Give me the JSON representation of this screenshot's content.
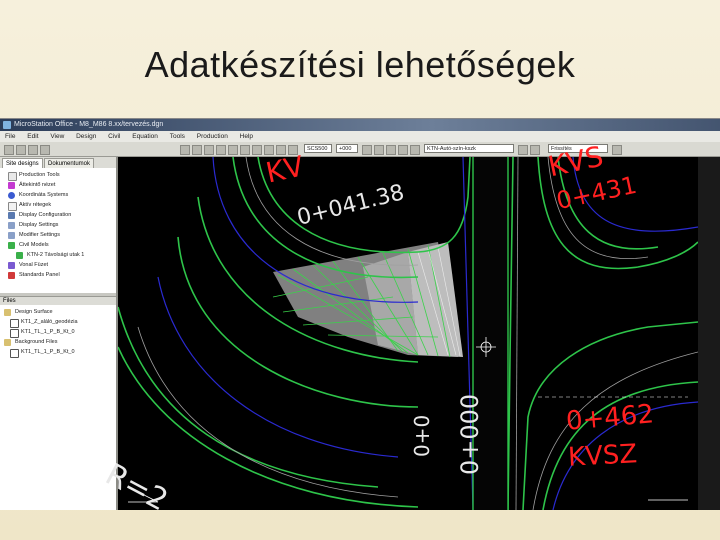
{
  "slide": {
    "title": "Adatkészítési lehetőségek"
  },
  "app": {
    "window_title": "MicroStation Office - M8_M86 8.xx/tervezés.dgn",
    "menu": [
      "File",
      "Edit",
      "View",
      "Design",
      "Civil",
      "Equation",
      "Tools",
      "Production",
      "Help"
    ],
    "combos": {
      "scale": "SCS500",
      "level": "+000",
      "feature": "KTN-Autó-szín-kszk",
      "style": "Frissítés"
    }
  },
  "left_panel": {
    "tabs": [
      "Site designs",
      "Dokumentumok"
    ],
    "tree": [
      "Production Tools",
      "Áttekintő nézet",
      "Koordináta Systems",
      "Aktív rétegek",
      "Display Configuration",
      "Display Settings",
      "Modifier Settings",
      "Civil Models",
      "KTN-2 Távolsági utak 1",
      "Vonal Füzet",
      "Standards Panel"
    ],
    "files_header": "Files",
    "files": [
      "Design Surface",
      "KT1_Z_aláló_geodézia",
      "KT1_TL_1_P_B_Kt_0",
      "Background Files",
      "KT1_TL_1_P_B_Kt_0"
    ]
  },
  "viewport": {
    "labels": {
      "station_top_left": "0+041.38",
      "station_top_right": "0+431",
      "station_bottom_right": "0+462",
      "kvsz_bottom": "KVSZ",
      "kvsz_top_left": "KV",
      "kvsz_top_right": "KVS",
      "vertical_station_a": "0+0",
      "vertical_station_b": "0+000",
      "radius_label": "R=2"
    },
    "colors": {
      "background": "#000000",
      "road_edge": "#2ec44a",
      "lane_line": "#b0b0b0",
      "boundary": "#2a2ad0",
      "station_text": "#ff2020",
      "surface": "#9a9a9a"
    }
  }
}
